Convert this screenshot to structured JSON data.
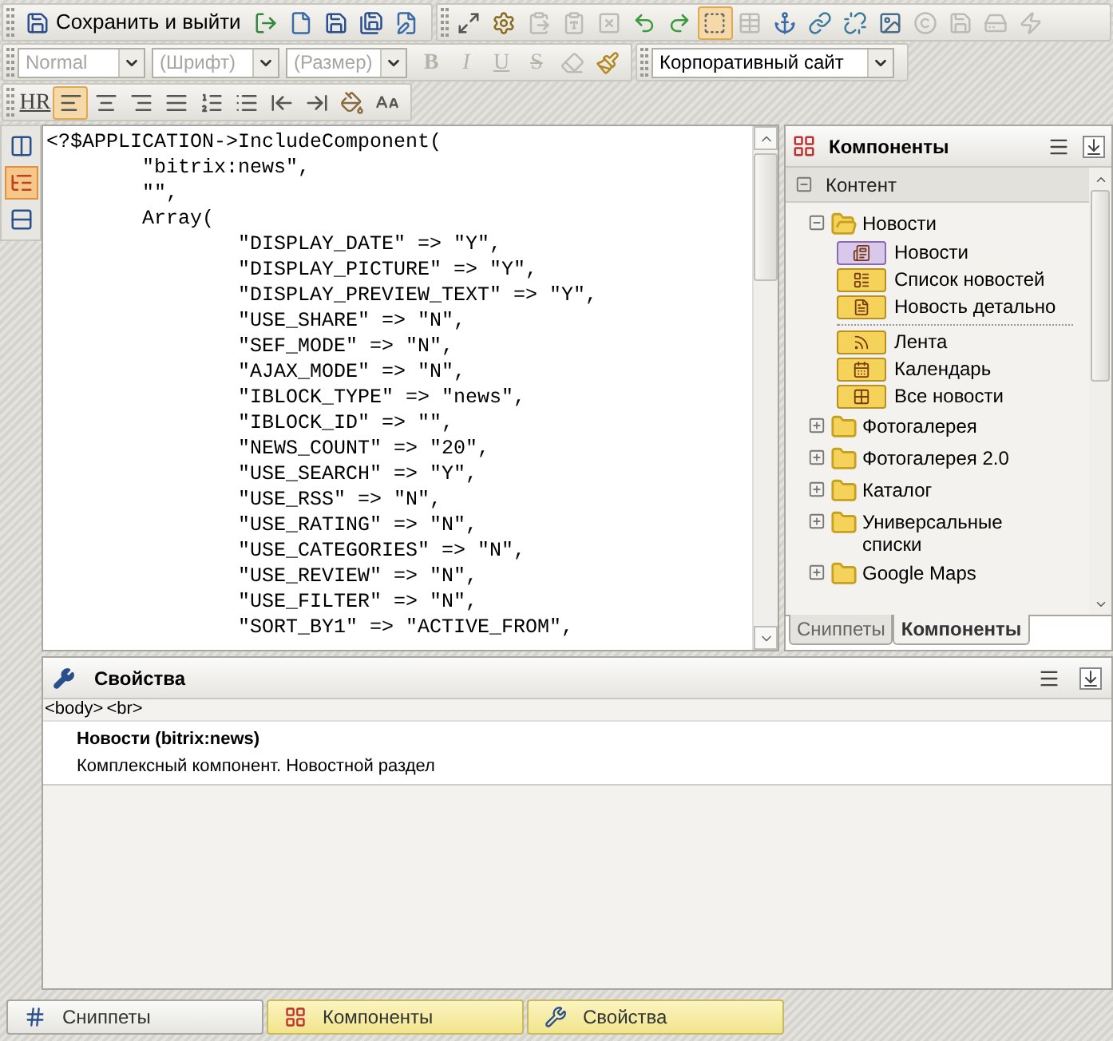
{
  "toolbar_main": {
    "save_button": "Сохранить и выйти",
    "tools": [
      {
        "kind": "exit",
        "disabled": false
      },
      {
        "kind": "new",
        "disabled": false
      },
      {
        "kind": "save",
        "disabled": false
      },
      {
        "kind": "saveas",
        "disabled": false
      },
      {
        "kind": "properties",
        "disabled": false
      }
    ]
  },
  "toolbar_edit": {
    "tools": [
      {
        "kind": "fullscreen",
        "disabled": false,
        "selected": false
      },
      {
        "kind": "settings",
        "disabled": false,
        "selected": false
      },
      {
        "kind": "pasteword",
        "disabled": true,
        "selected": false
      },
      {
        "kind": "pastetext",
        "disabled": true,
        "selected": false
      },
      {
        "kind": "cleanup",
        "disabled": true,
        "selected": false
      },
      {
        "kind": "undo",
        "disabled": false,
        "selected": false
      },
      {
        "kind": "redo",
        "disabled": false,
        "selected": false
      },
      {
        "kind": "select",
        "disabled": false,
        "selected": true
      },
      {
        "kind": "table",
        "disabled": true,
        "selected": false
      },
      {
        "kind": "anchor",
        "disabled": false,
        "selected": false
      },
      {
        "kind": "link",
        "disabled": false,
        "selected": false
      },
      {
        "kind": "unlink",
        "disabled": false,
        "selected": false
      },
      {
        "kind": "image",
        "disabled": false,
        "selected": false
      },
      {
        "kind": "copyright",
        "disabled": true,
        "selected": false
      },
      {
        "kind": "savetemplate",
        "disabled": true,
        "selected": false
      },
      {
        "kind": "loadtemplate",
        "disabled": true,
        "selected": false
      },
      {
        "kind": "flash",
        "disabled": true,
        "selected": false
      }
    ]
  },
  "toolbar_format": {
    "selects": [
      {
        "value": "Normal",
        "disabled": true
      },
      {
        "value": "(Шрифт)",
        "disabled": true
      },
      {
        "value": "(Размер)",
        "disabled": true
      }
    ],
    "tools": [
      {
        "kind": "bold",
        "label": "B",
        "disabled": true
      },
      {
        "kind": "italic",
        "label": "I",
        "disabled": true
      },
      {
        "kind": "underline",
        "label": "U",
        "disabled": true
      },
      {
        "kind": "strike",
        "label": "S",
        "disabled": true
      },
      {
        "kind": "eraser",
        "disabled": true
      },
      {
        "kind": "brush",
        "disabled": false
      }
    ]
  },
  "template_select": {
    "value": "Корпоративный сайт"
  },
  "toolbar_paragraph": {
    "tools": [
      {
        "kind": "hr",
        "label": "HR",
        "selected": false
      },
      {
        "kind": "alignleft",
        "selected": true
      },
      {
        "kind": "aligncenter",
        "selected": false
      },
      {
        "kind": "alignright",
        "selected": false
      },
      {
        "kind": "justify",
        "selected": false
      },
      {
        "kind": "ol",
        "selected": false
      },
      {
        "kind": "ul",
        "selected": false
      },
      {
        "kind": "outdent",
        "selected": false
      },
      {
        "kind": "indent",
        "selected": false
      },
      {
        "kind": "paintformat",
        "selected": false
      },
      {
        "kind": "fontsize",
        "selected": false
      }
    ]
  },
  "view_modes": [
    {
      "kind": "split",
      "selected": false
    },
    {
      "kind": "code",
      "selected": true
    },
    {
      "kind": "visual",
      "selected": false
    }
  ],
  "code_lines": [
    "<?$APPLICATION->IncludeComponent(",
    "        \"bitrix:news\",",
    "        \"\",",
    "        Array(",
    "                \"DISPLAY_DATE\" => \"Y\",",
    "                \"DISPLAY_PICTURE\" => \"Y\",",
    "                \"DISPLAY_PREVIEW_TEXT\" => \"Y\",",
    "                \"USE_SHARE\" => \"N\",",
    "                \"SEF_MODE\" => \"N\",",
    "                \"AJAX_MODE\" => \"N\",",
    "                \"IBLOCK_TYPE\" => \"news\",",
    "                \"IBLOCK_ID\" => \"\",",
    "                \"NEWS_COUNT\" => \"20\",",
    "                \"USE_SEARCH\" => \"Y\",",
    "                \"USE_RSS\" => \"N\",",
    "                \"USE_RATING\" => \"N\",",
    "                \"USE_CATEGORIES\" => \"N\",",
    "                \"USE_REVIEW\" => \"N\",",
    "                \"USE_FILTER\" => \"N\",",
    "                \"SORT_BY1\" => \"ACTIVE_FROM\","
  ],
  "components_panel": {
    "title": "Компоненты",
    "section": {
      "label": "Контент",
      "expanded": true
    },
    "tree": [
      {
        "label": "Новости",
        "expanded": true,
        "children": [
          {
            "kind": "complex",
            "label": "Новости"
          },
          {
            "kind": "list",
            "label": "Список новостей"
          },
          {
            "kind": "detail",
            "label": "Новость детально"
          },
          {
            "kind": "separator"
          },
          {
            "kind": "feed",
            "label": "Лента"
          },
          {
            "kind": "calendar",
            "label": "Календарь"
          },
          {
            "kind": "all",
            "label": "Все новости"
          }
        ]
      },
      {
        "label": "Фотогалерея",
        "expanded": false
      },
      {
        "label": "Фотогалерея 2.0",
        "expanded": false
      },
      {
        "label": "Каталог",
        "expanded": false
      },
      {
        "label": "Универсальные списки",
        "expanded": false
      },
      {
        "label": "Google Maps",
        "expanded": false
      }
    ],
    "tabs": [
      {
        "label": "Сниппеты",
        "selected": false
      },
      {
        "label": "Компоненты",
        "selected": true
      }
    ]
  },
  "properties_panel": {
    "title": "Свойства",
    "breadcrumb": [
      "<body>",
      "<br>"
    ],
    "component_title": "Новости (bitrix:news)",
    "component_description": "Комплексный компонент. Новостной раздел"
  },
  "taskbar": [
    {
      "kind": "snippets",
      "label": "Сниппеты",
      "open": false
    },
    {
      "kind": "components",
      "label": "Компоненты",
      "open": true
    },
    {
      "kind": "properties",
      "label": "Свойства",
      "open": true
    }
  ]
}
